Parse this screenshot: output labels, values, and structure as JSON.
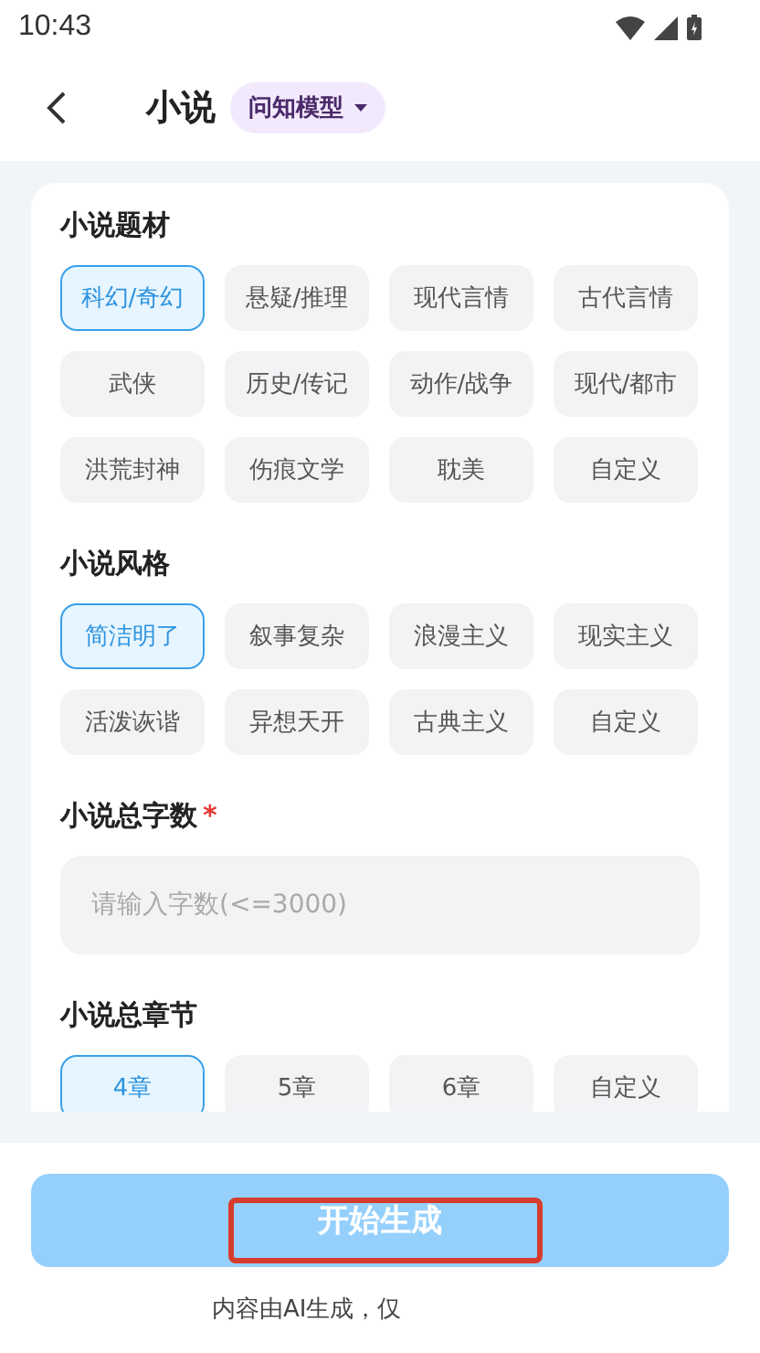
{
  "status_bar": {
    "time": "10:43"
  },
  "header": {
    "title": "小说",
    "model": "问知模型"
  },
  "sections": [
    {
      "kind": "chips",
      "title": "小说题材",
      "options": [
        {
          "label": "科幻/奇幻",
          "selected": true
        },
        {
          "label": "悬疑/推理",
          "selected": false
        },
        {
          "label": "现代言情",
          "selected": false
        },
        {
          "label": "古代言情",
          "selected": false
        },
        {
          "label": "武侠",
          "selected": false
        },
        {
          "label": "历史/传记",
          "selected": false
        },
        {
          "label": "动作/战争",
          "selected": false
        },
        {
          "label": "现代/都市",
          "selected": false
        },
        {
          "label": "洪荒封神",
          "selected": false
        },
        {
          "label": "伤痕文学",
          "selected": false
        },
        {
          "label": "耽美",
          "selected": false
        },
        {
          "label": "自定义",
          "selected": false
        }
      ]
    },
    {
      "kind": "chips",
      "title": "小说风格",
      "options": [
        {
          "label": "简洁明了",
          "selected": true
        },
        {
          "label": "叙事复杂",
          "selected": false
        },
        {
          "label": "浪漫主义",
          "selected": false
        },
        {
          "label": "现实主义",
          "selected": false
        },
        {
          "label": "活泼诙谐",
          "selected": false
        },
        {
          "label": "异想天开",
          "selected": false
        },
        {
          "label": "古典主义",
          "selected": false
        },
        {
          "label": "自定义",
          "selected": false
        }
      ]
    },
    {
      "kind": "input",
      "title": "小说总字数",
      "required_mark": "*",
      "placeholder": "请输入字数(<=3000)"
    },
    {
      "kind": "chips",
      "title": "小说总章节",
      "options": [
        {
          "label": "4章",
          "selected": true
        },
        {
          "label": "5章",
          "selected": false
        },
        {
          "label": "6章",
          "selected": false
        },
        {
          "label": "自定义",
          "selected": false
        }
      ]
    }
  ],
  "generate_button": {
    "label": "开始生成",
    "highlighted": true
  },
  "disclaimer": "内容由AI生成，仅"
}
